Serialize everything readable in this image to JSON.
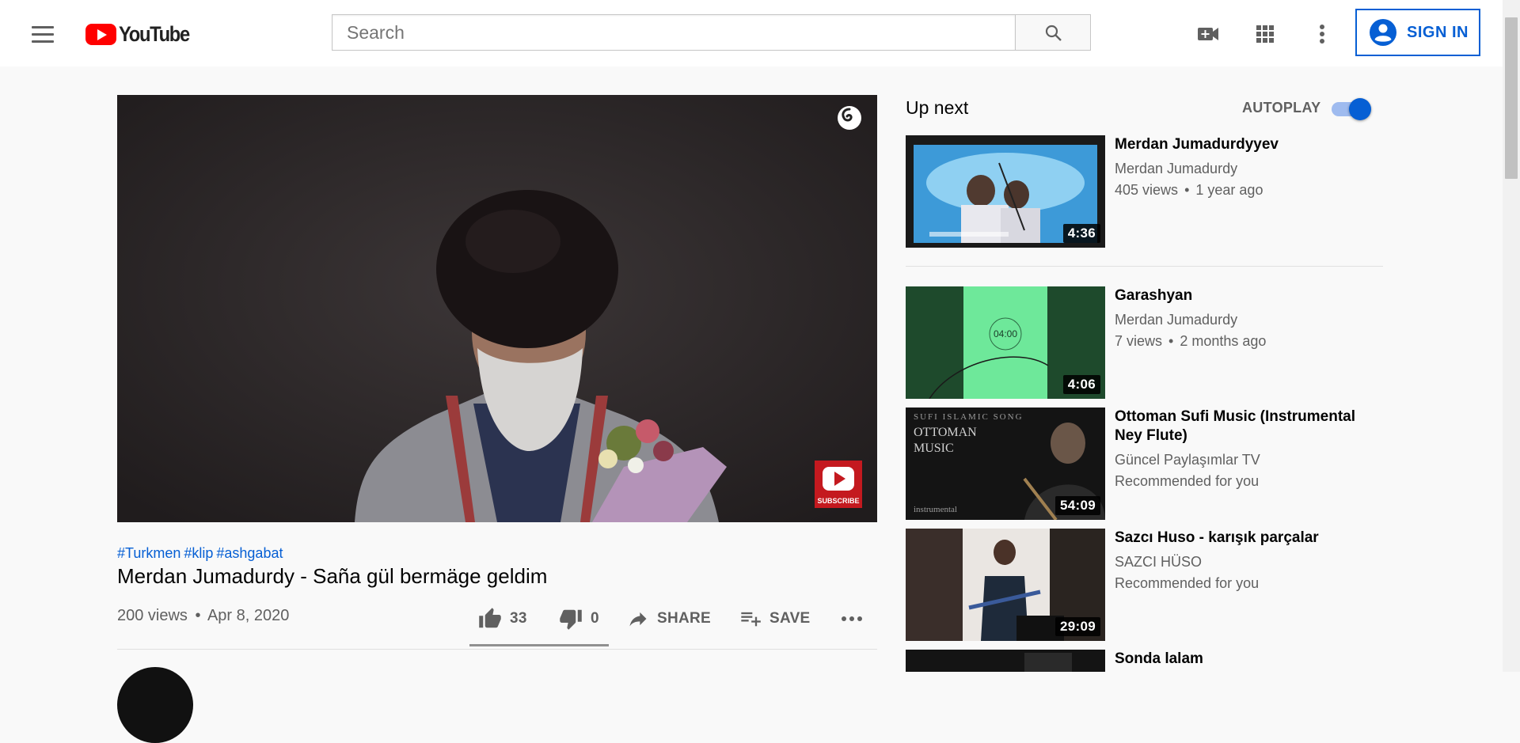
{
  "header": {
    "logo_text": "YouTube",
    "search_placeholder": "Search",
    "search_value": "",
    "signin_label": "SIGN IN",
    "icons": [
      "menu-icon",
      "search-icon",
      "create-video-icon",
      "apps-grid-icon",
      "more-vert-icon",
      "account-circle-icon"
    ]
  },
  "video": {
    "hashtags": [
      "#Turkmen",
      "#klip",
      "#ashgabat"
    ],
    "title": "Merdan Jumadurdy - Sañа gül bermäge geldim",
    "views": "200 views",
    "dot": "•",
    "date": "Apr 8, 2020",
    "likes": "33",
    "dislikes": "0",
    "like_ratio": 1.0,
    "share_label": "SHARE",
    "save_label": "SAVE",
    "watermark_label": "SUBSCRIBE"
  },
  "sidebar": {
    "up_next_label": "Up next",
    "autoplay_label": "AUTOPLAY",
    "autoplay_on": true,
    "items": [
      {
        "title": "Merdan Jumadurdyyev",
        "channel": "Merdan Jumadurdy",
        "views": "405 views",
        "age": "1 year ago",
        "duration": "4:36"
      },
      {
        "title": "Garashyan",
        "channel": "Merdan Jumadurdy",
        "views": "7 views",
        "age": "2 months ago",
        "duration": "4:06",
        "thumb_text": "04:00"
      },
      {
        "title": "Ottoman Sufi Music (Instrumental Ney Flute)",
        "channel": "Güncel Paylaşımlar TV",
        "meta": "Recommended for you",
        "duration": "54:09",
        "thumb_caption": "SUFI ISLAMIC SONG",
        "thumb_heading": "OTTOMAN MUSIC",
        "thumb_footer": "instrumental"
      },
      {
        "title": "Sazcı Huso - karışık parçalar",
        "channel": "SAZCI HÜSO",
        "meta": "Recommended for you",
        "duration": "29:09"
      },
      {
        "title": "Sonda lalam"
      }
    ]
  },
  "colors": {
    "brand_red": "#ff0000",
    "link_blue": "#065fd4",
    "text_secondary": "#606060",
    "page_bg": "#f9f9f9"
  }
}
